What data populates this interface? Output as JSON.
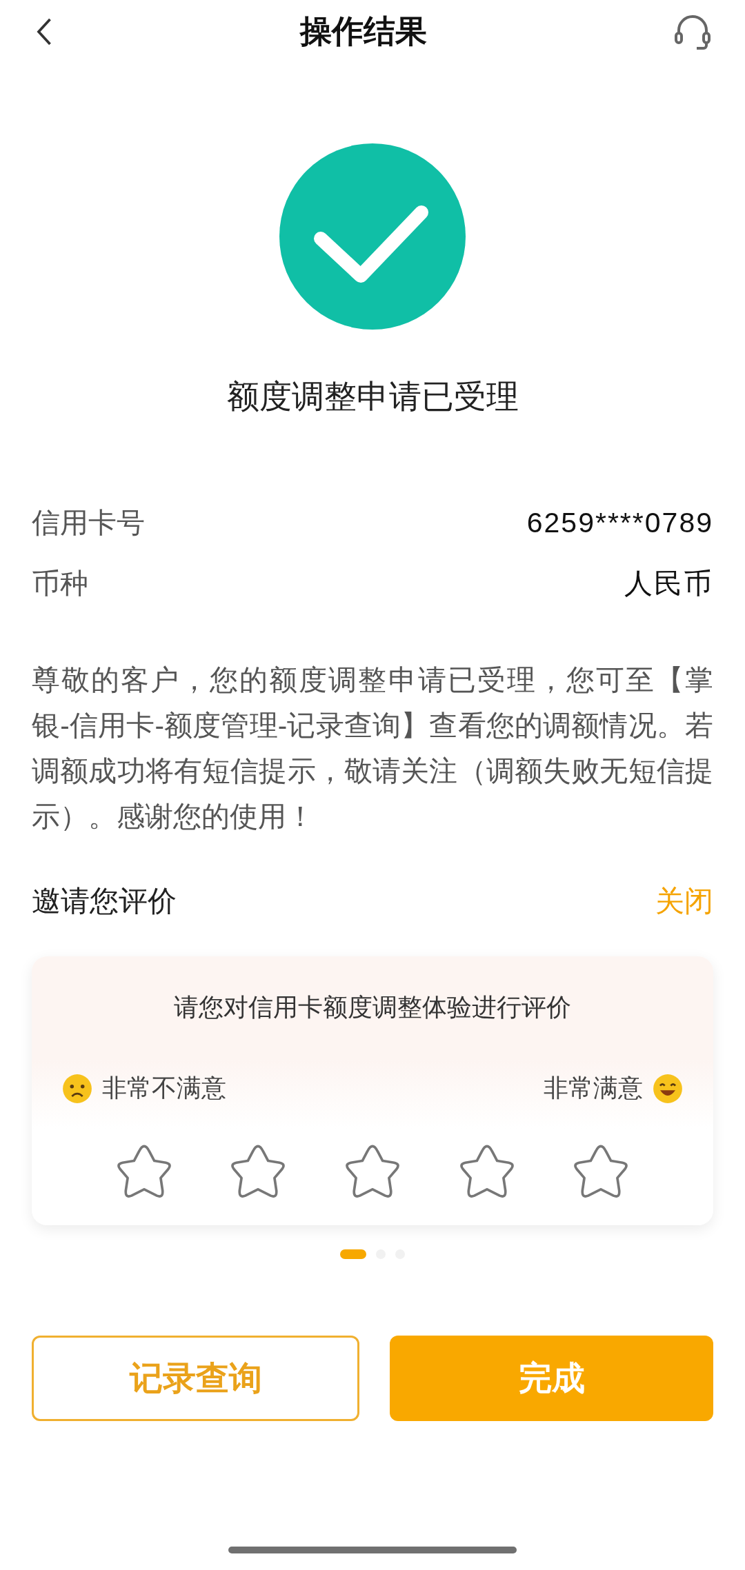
{
  "header": {
    "title": "操作结果"
  },
  "result": {
    "kind": "success",
    "message": "额度调整申请已受理"
  },
  "details": [
    {
      "label": "信用卡号",
      "value": "6259****0789"
    },
    {
      "label": "币种",
      "value": "人民币"
    }
  ],
  "notice": "尊敬的客户，您的额度调整申请已受理，您可至【掌银-信用卡-额度管理-记录查询】查看您的调额情况。若调额成功将有短信提示，敬请关注（调额失败无短信提示）。感谢您的使用！",
  "survey": {
    "heading": "邀请您评价",
    "close": "关闭",
    "question": "请您对信用卡额度调整体验进行评价",
    "low_label": "非常不满意",
    "high_label": "非常满意",
    "stars": 0
  },
  "pager": [
    {
      "selected": true
    },
    {
      "selected": false
    },
    {
      "selected": false
    }
  ],
  "buttons": [
    {
      "label": "记录查询",
      "kind": "outline"
    },
    {
      "label": "完成",
      "kind": "primary"
    }
  ]
}
